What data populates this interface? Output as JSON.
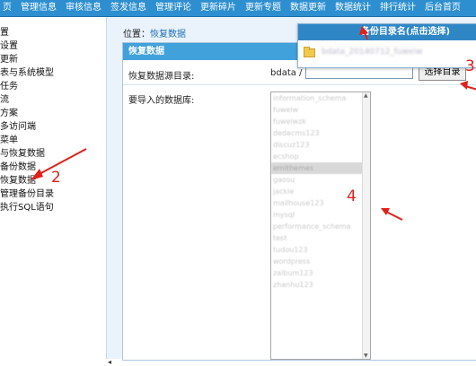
{
  "topnav": {
    "items": [
      "页",
      "管理信息",
      "审核信息",
      "签发信息",
      "管理评论",
      "更新碎片",
      "更新专题",
      "数据更新",
      "数据统计",
      "排行统计",
      "后台首页"
    ]
  },
  "sidebar": {
    "items": [
      "置",
      "设置",
      "更新",
      "表与系统模型",
      "任务",
      "流",
      "方案",
      "多访问端",
      "菜单",
      "与恢复数据",
      "备份数据",
      "恢复数据",
      "管理备份目录",
      "执行SQL语句"
    ]
  },
  "main": {
    "breadcrumb_prefix": "位置：",
    "breadcrumb_link": "恢复数据",
    "panel_title": "恢复数据",
    "source_dir_label": "恢复数据源目录:",
    "source_dir_prefix": "bdata /",
    "source_dir_value": "",
    "choose_button": "选择目录",
    "db_list_label": "要导入的数据库:",
    "db_options": [
      "information_schema",
      "fuweiw",
      "fuweiwzk",
      "dedecms123",
      "discuz123",
      "ecshop",
      "emlthemes",
      "gaosu",
      "jackie",
      "mailhouse123",
      "mysql",
      "performance_schema",
      "test",
      "tudou123",
      "wordpress",
      "zalbum123",
      "zhanhu123"
    ],
    "db_selected_index": 6
  },
  "popup": {
    "title": "备份目录名(点击选择)",
    "folder_name": "bdata_20140712_fuweiw"
  },
  "annotations": [
    "2",
    "3",
    "4"
  ],
  "colors": {
    "nav": "#2d8fd0",
    "panel_head": "#41a2db",
    "annotation": "#e0201a",
    "bg": "#eaf3fb"
  }
}
